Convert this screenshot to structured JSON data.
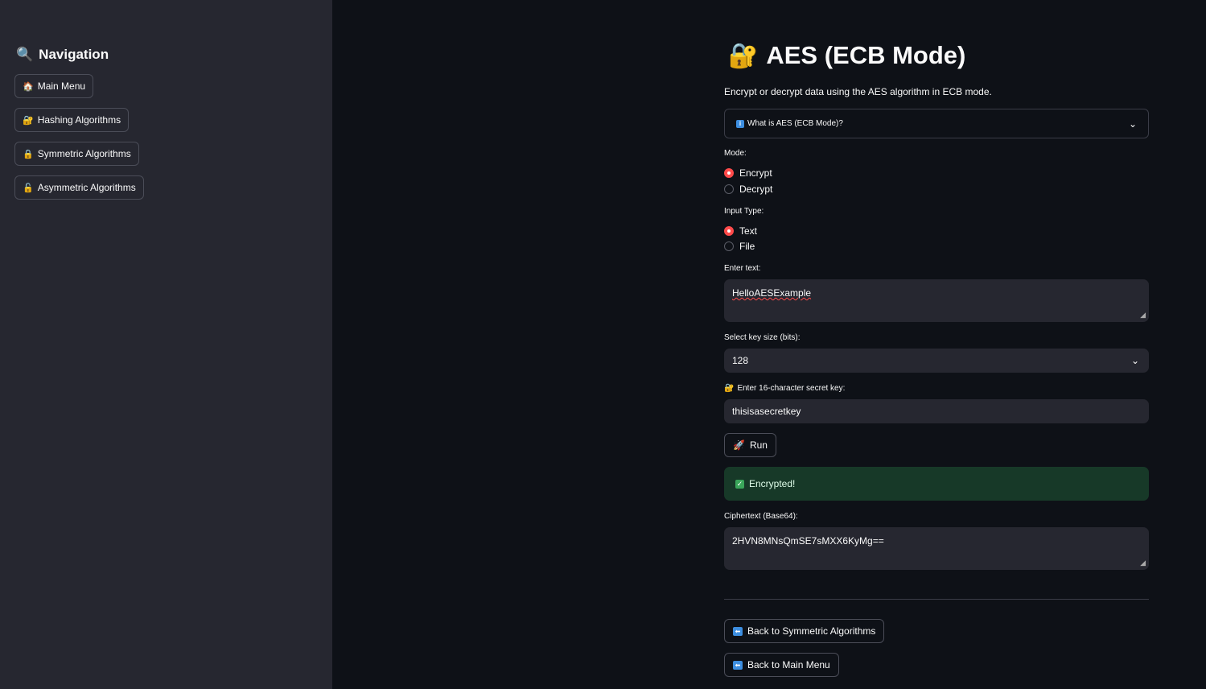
{
  "sidebar": {
    "title": "Navigation",
    "title_icon": "🔍",
    "items": [
      {
        "icon": "🏠",
        "label": "Main Menu"
      },
      {
        "icon": "🔐",
        "label": "Hashing Algorithms"
      },
      {
        "icon": "🔒",
        "label": "Symmetric Algorithms"
      },
      {
        "icon": "🔓",
        "label": "Asymmetric Algorithms"
      }
    ]
  },
  "main": {
    "title_icon": "🔐",
    "title": "AES (ECB Mode)",
    "subtitle": "Encrypt or decrypt data using the AES algorithm in ECB mode.",
    "expander": {
      "icon": "i",
      "label": "What is AES (ECB Mode)?"
    },
    "mode": {
      "label": "Mode:",
      "options": [
        "Encrypt",
        "Decrypt"
      ],
      "selected": "Encrypt"
    },
    "input_type": {
      "label": "Input Type:",
      "options": [
        "Text",
        "File"
      ],
      "selected": "Text"
    },
    "text_input": {
      "label": "Enter text:",
      "value": "HelloAESExample"
    },
    "key_size": {
      "label": "Select key size (bits):",
      "value": "128"
    },
    "secret_key": {
      "icon": "🔐",
      "label": "Enter 16-character secret key:",
      "value": "thisisasecretkey"
    },
    "run_button": {
      "icon": "🚀",
      "label": "Run"
    },
    "status": {
      "icon": "✓",
      "text": "Encrypted!"
    },
    "output": {
      "label": "Ciphertext (Base64):",
      "value": "2HVN8MNsQmSE7sMXX6KyMg=="
    },
    "back_symmetric": {
      "icon": "⬅",
      "label": "Back to Symmetric Algorithms"
    },
    "back_main": {
      "icon": "⬅",
      "label": "Back to Main Menu"
    }
  },
  "colors": {
    "background": "#0e1117",
    "sidebar": "#262730",
    "accent": "#ff4b4b",
    "success_bg": "#173928",
    "info": "#3d8ee0"
  }
}
